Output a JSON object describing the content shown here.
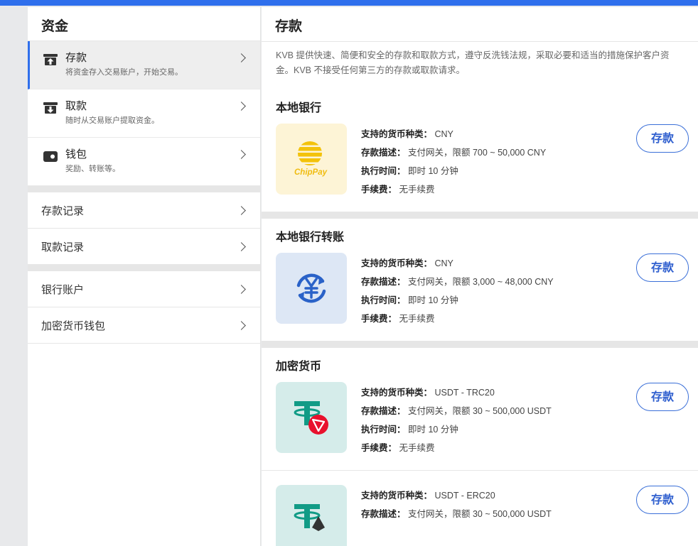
{
  "colors": {
    "accent": "#2f6fec",
    "button_border": "#3a6fd8"
  },
  "sidebar": {
    "title": "资金",
    "fund_items": [
      {
        "label": "存款",
        "sub": "将资金存入交易账户，开始交易。",
        "icon": "deposit-icon"
      },
      {
        "label": "取款",
        "sub": "随时从交易账户提取资金。",
        "icon": "withdraw-icon"
      },
      {
        "label": "钱包",
        "sub": "奖励、转账等。",
        "icon": "wallet-icon"
      }
    ],
    "record_links": [
      "存款记录",
      "取款记录"
    ],
    "account_links": [
      "银行账户",
      "加密货币钱包"
    ]
  },
  "main": {
    "title": "存款",
    "intro": "KVB 提供快速、简便和安全的存款和取款方式，遵守反洗钱法规，采取必要和适当的措施保护客户资金。KVB 不接受任何第三方的存款或取款请求。",
    "labels": {
      "currency": "支持的货币种类：",
      "desc": "存款描述：",
      "time": "执行时间：",
      "fee": "手续费："
    },
    "button_label": "存款",
    "sections": [
      {
        "title": "本地银行",
        "method": {
          "logo": "chippay-logo",
          "logo_text": "ChipPay",
          "currency": "CNY",
          "desc": "支付网关，限额 700 ~ 50,000 CNY",
          "time": "即时 10 分钟",
          "fee": "无手续费"
        }
      },
      {
        "title": "本地银行转账",
        "method": {
          "logo": "yuan-transfer-icon",
          "currency": "CNY",
          "desc": "支付网关，限额 3,000 ~ 48,000 CNY",
          "time": "即时 10 分钟",
          "fee": "无手续费"
        }
      },
      {
        "title": "加密货币",
        "methods": [
          {
            "logo": "usdt-trc20-logo",
            "currency": "USDT - TRC20",
            "desc": "支付网关，限额 30 ~ 500,000 USDT",
            "time": "即时 10 分钟",
            "fee": "无手续费"
          },
          {
            "logo": "usdt-erc20-logo",
            "currency": "USDT - ERC20",
            "desc": "支付网关，限额 30 ~ 500,000 USDT"
          }
        ]
      }
    ]
  }
}
